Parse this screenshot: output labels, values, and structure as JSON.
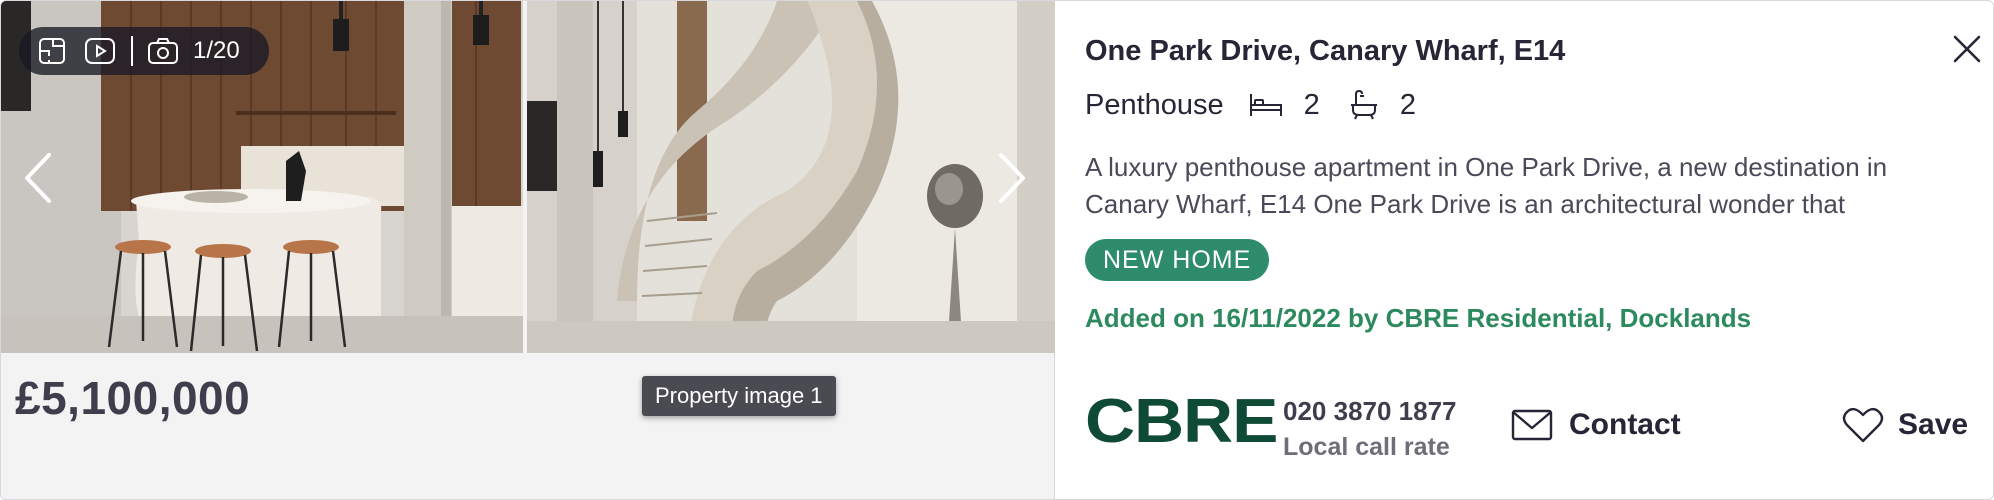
{
  "gallery": {
    "image_count": "1/20",
    "tooltip": "Property image 1",
    "price": "£5,100,000"
  },
  "listing": {
    "address": "One Park Drive, Canary Wharf, E14",
    "property_type": "Penthouse",
    "bedrooms": "2",
    "bathrooms": "2",
    "description": "A luxury penthouse apartment in One Park Drive, a new destination in Canary Wharf, E14 One Park Drive is an architectural wonder that",
    "badge": "NEW HOME",
    "added": "Added on 16/11/2022 by CBRE Residential, Docklands"
  },
  "agent": {
    "logo_text": "CBRE",
    "phone": "020 3870 1877",
    "phone_note": "Local call rate"
  },
  "actions": {
    "contact_label": "Contact",
    "save_label": "Save"
  },
  "colors": {
    "accent_green": "#2d8a5e",
    "badge_green": "#2e8c6c",
    "logo_green": "#0f4a35",
    "text_dark": "#262637"
  },
  "icons": [
    "floorplan-icon",
    "video-icon",
    "camera-icon",
    "chevron-left-icon",
    "chevron-right-icon",
    "close-icon",
    "bed-icon",
    "bath-icon",
    "mail-icon",
    "heart-icon"
  ]
}
